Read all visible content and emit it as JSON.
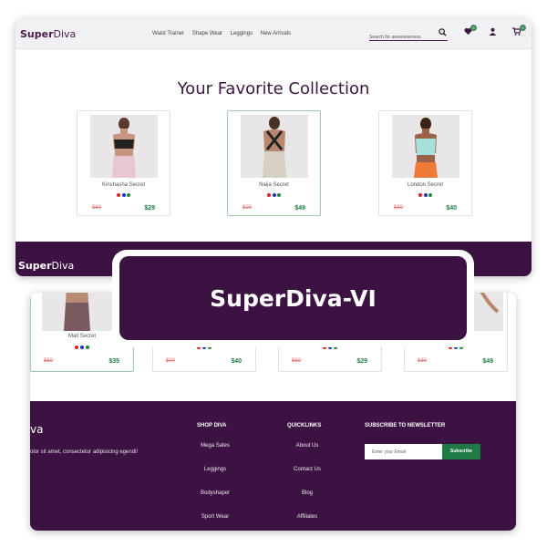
{
  "top": {
    "brand_bold": "Super",
    "brand_rest": "Diva",
    "nav_links": [
      "Waist Trainer",
      "Shape Wear",
      "Leggings",
      "New Arrivals"
    ],
    "search_placeholder": "Search for awesomeness",
    "cart_badge": "0",
    "wishlist_badge": "0",
    "section_title": "Your Favorite Collection",
    "products": [
      {
        "name": "Kinshasha Secret",
        "old_price": "$60",
        "new_price": "$29",
        "dots": [
          "#e02020",
          "#2030d0",
          "#1e8a3a"
        ]
      },
      {
        "name": "Naija Secret",
        "old_price": "$90",
        "new_price": "$49",
        "dots": [
          "#e02020",
          "#2030d0",
          "#1e8a3a"
        ]
      },
      {
        "name": "London Secret",
        "old_price": "$80",
        "new_price": "$40",
        "dots": [
          "#e02020",
          "#2030d0",
          "#1e8a3a"
        ]
      }
    ],
    "footer_brand_bold": "Super",
    "footer_brand_rest": "Diva"
  },
  "overlay_title": "SuperDiva-VI",
  "bottom": {
    "products": [
      {
        "name": "Mali Secret",
        "old_price": "$50",
        "new_price": "$35"
      },
      {
        "name": "",
        "old_price": "$90",
        "new_price": "$40"
      },
      {
        "name": "",
        "old_price": "$60",
        "new_price": "$29"
      },
      {
        "name": "",
        "old_price": "$80",
        "new_price": "$49"
      }
    ],
    "footer_brand": "va",
    "footer_text": "olor sit amet, consectetur adipisicing egendi!",
    "shop_title": "SHOP DIVA",
    "shop_items": [
      "Mega Sales",
      "Leggings",
      "Bodyshaper",
      "Sport Wear"
    ],
    "quick_title": "QUICKLINKS",
    "quick_items": [
      "About Us",
      "Contact Us",
      "Blog",
      "Affiliates"
    ],
    "news_title": "SUBSCRIBE TO NEWSLETTER",
    "news_placeholder": "Enter your Email",
    "news_button": "Subscribe"
  },
  "colors": {
    "brand_purple": "#3b1242",
    "accent_green": "#1e7b45",
    "old_price_red": "#e07a7a"
  }
}
